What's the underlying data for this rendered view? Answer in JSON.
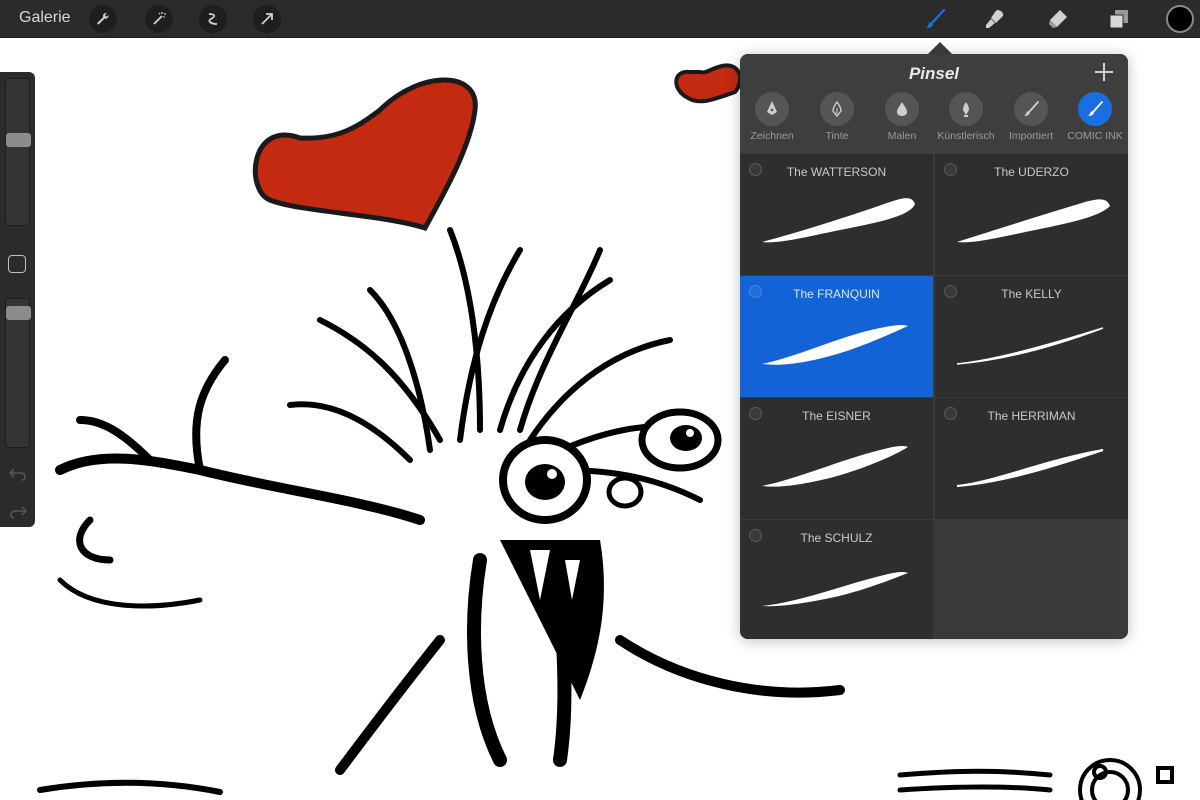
{
  "toolbar": {
    "gallery_label": "Galerie",
    "left_tools": [
      "wrench-icon",
      "magic-wand-icon",
      "selection-icon",
      "transform-arrow-icon"
    ],
    "right_tools": [
      "brush-icon",
      "smudge-icon",
      "eraser-icon",
      "layers-icon"
    ],
    "active_tool": "brush",
    "current_color": "#000000",
    "accent_color": "#1a6fe0"
  },
  "sidebar": {
    "brush_size_level": 0.6,
    "opacity_level": 0.95
  },
  "brush_panel": {
    "title": "Pinsel",
    "categories": [
      {
        "label": "Zeichnen",
        "icon": "pencil-nib-icon"
      },
      {
        "label": "Tinte",
        "icon": "ink-pen-icon"
      },
      {
        "label": "Malen",
        "icon": "drop-icon"
      },
      {
        "label": "Künstlerisch",
        "icon": "artistic-nib-icon"
      },
      {
        "label": "Importiert",
        "icon": "imported-brush-icon"
      },
      {
        "label": "COMIC INK",
        "icon": "comic-brush-icon"
      }
    ],
    "active_category": "COMIC INK",
    "brushes": [
      {
        "name": "The WATTERSON"
      },
      {
        "name": "The UDERZO"
      },
      {
        "name": "The FRANQUIN"
      },
      {
        "name": "The KELLY"
      },
      {
        "name": "The EISNER"
      },
      {
        "name": "The HERRIMAN"
      },
      {
        "name": "The SCHULZ"
      }
    ],
    "selected_brush": "The FRANQUIN",
    "selected_color": "#1363d6"
  },
  "canvas": {
    "heart_color": "#c42a12"
  }
}
